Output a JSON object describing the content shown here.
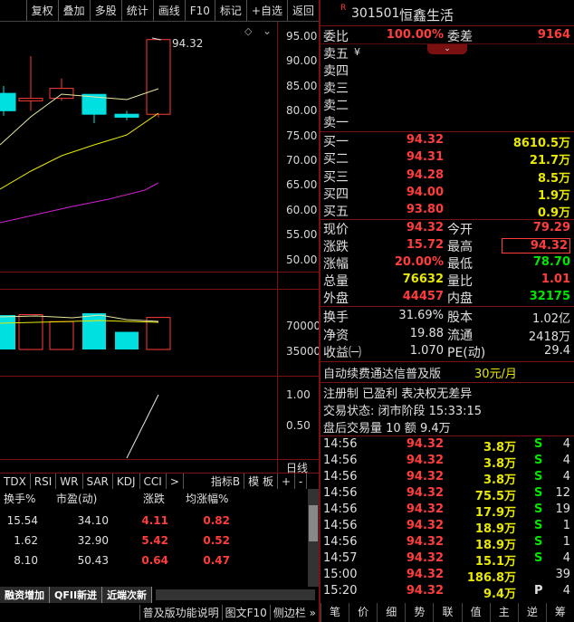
{
  "toolbar": {
    "buttons": [
      "复权",
      "叠加",
      "多股",
      "统计",
      "画线",
      "F10",
      "标记",
      "+自选",
      "返回"
    ]
  },
  "chart": {
    "price_label": "94.32",
    "price_axis": [
      "95.00",
      "90.00",
      "85.00",
      "80.00",
      "75.00",
      "70.00",
      "65.00",
      "60.00",
      "55.00",
      "50.00"
    ],
    "vol_axis": [
      "70000",
      "35000"
    ],
    "ind_axis": [
      "1.00",
      "0.50"
    ],
    "pane_label": "日线",
    "candles": [
      {
        "open": 83.5,
        "close": 80.0,
        "high": 85.0,
        "low": 79.0,
        "up": true
      },
      {
        "open": 82.0,
        "close": 82.5,
        "high": 91.0,
        "low": 80.0,
        "up": true
      },
      {
        "open": 82.5,
        "close": 84.5,
        "high": 86.5,
        "low": 82.0,
        "up": true
      },
      {
        "open": 83.3,
        "close": 79.3,
        "high": 83.3,
        "low": 77.5,
        "up": false
      },
      {
        "open": 79.3,
        "close": 78.7,
        "high": 80.0,
        "low": 78.1,
        "up": false
      },
      {
        "open": 79.29,
        "close": 94.32,
        "high": 94.32,
        "low": 78.7,
        "up": true
      }
    ],
    "volumes": [
      74000,
      75000,
      60000,
      78000,
      38000,
      69000
    ]
  },
  "ind_tabs": [
    "TDX",
    "RSI",
    "WR",
    "SAR",
    "KDJ",
    "CCI",
    ">",
    "指标B",
    "模 板",
    "+",
    "-"
  ],
  "table": {
    "headers": [
      "换手%",
      "市盈(动)",
      "涨跌",
      "均涨幅%"
    ],
    "rows": [
      [
        "15.54",
        "34.10",
        "4.11",
        "0.82"
      ],
      [
        "1.62",
        "32.90",
        "5.42",
        "0.52"
      ],
      [
        "8.10",
        "50.43",
        "0.64",
        "0.47"
      ]
    ]
  },
  "bottom_tabs": [
    "融资增加",
    "QFII新进",
    "近端次新"
  ],
  "status_bar": [
    "普及版功能说明",
    "图文F10",
    "侧边栏 »"
  ],
  "quote": {
    "code": "301501",
    "name": "恒鑫生活",
    "weibi_label": "委比",
    "weibi": "100.00%",
    "weicha_label": "委差",
    "weicha": "9164",
    "sell": [
      {
        "label": "卖五",
        "price": "",
        "vol": ""
      },
      {
        "label": "卖四",
        "price": "",
        "vol": ""
      },
      {
        "label": "卖三",
        "price": "",
        "vol": ""
      },
      {
        "label": "卖二",
        "price": "",
        "vol": ""
      },
      {
        "label": "卖一",
        "price": "",
        "vol": ""
      }
    ],
    "sell_currency": "¥",
    "buy": [
      {
        "label": "买一",
        "price": "94.32",
        "vol": "8610.5万"
      },
      {
        "label": "买二",
        "price": "94.31",
        "vol": "21.7万"
      },
      {
        "label": "买三",
        "price": "94.28",
        "vol": "8.5万"
      },
      {
        "label": "买四",
        "price": "94.00",
        "vol": "1.9万"
      },
      {
        "label": "买五",
        "price": "93.80",
        "vol": "0.9万"
      }
    ],
    "stats1": [
      {
        "l1": "现价",
        "v1": "94.32",
        "l2": "今开",
        "v2": "79.29"
      },
      {
        "l1": "涨跌",
        "v1": "15.72",
        "l2": "最高",
        "v2": "94.32"
      },
      {
        "l1": "涨幅",
        "v1": "20.00%",
        "l2": "最低",
        "v2": "78.70"
      },
      {
        "l1": "总量",
        "v1": "76632",
        "l2": "量比",
        "v2": "1.01"
      },
      {
        "l1": "外盘",
        "v1": "44457",
        "l2": "内盘",
        "v2": "32175"
      }
    ],
    "stats2": [
      {
        "l1": "换手",
        "v1": "31.69%",
        "l2": "股本",
        "v2": "1.02亿"
      },
      {
        "l1": "净资",
        "v1": "19.88",
        "l2": "流通",
        "v2": "2418万"
      },
      {
        "l1": "收益㈠",
        "v1": "1.070",
        "l2": "PE(动)",
        "v2": "29.4"
      }
    ],
    "promo": "自动续费通达信普及版",
    "promo_price": "30元/月",
    "info1": "注册制 已盈利 表决权无差异",
    "status": "交易状态: 闭市阶段 15:33:15",
    "after_hours": "盘后交易量 10 额 9.4万",
    "ticks": [
      {
        "time": "14:56",
        "price": "94.32",
        "vol": "3.8万",
        "side": "S",
        "n": "4"
      },
      {
        "time": "14:56",
        "price": "94.32",
        "vol": "3.8万",
        "side": "S",
        "n": "4"
      },
      {
        "time": "14:56",
        "price": "94.32",
        "vol": "3.8万",
        "side": "S",
        "n": "4"
      },
      {
        "time": "14:56",
        "price": "94.32",
        "vol": "75.5万",
        "side": "S",
        "n": "12"
      },
      {
        "time": "14:56",
        "price": "94.32",
        "vol": "17.9万",
        "side": "S",
        "n": "19"
      },
      {
        "time": "14:56",
        "price": "94.32",
        "vol": "18.9万",
        "side": "S",
        "n": "1"
      },
      {
        "time": "14:56",
        "price": "94.32",
        "vol": "18.9万",
        "side": "S",
        "n": "1"
      },
      {
        "time": "14:57",
        "price": "94.32",
        "vol": "15.1万",
        "side": "S",
        "n": "4"
      },
      {
        "time": "15:00",
        "price": "94.32",
        "vol": "186.8万",
        "side": "",
        "n": "39"
      },
      {
        "time": "15:20",
        "price": "94.32",
        "vol": "9.4万",
        "side": "P",
        "n": "4"
      }
    ],
    "tabs": [
      "笔",
      "价",
      "细",
      "势",
      "联",
      "值",
      "主",
      "逆",
      "筹"
    ]
  },
  "colors": {
    "up": "#ff3d3d",
    "down": "#00e0e0",
    "grid": "#7a1010"
  }
}
